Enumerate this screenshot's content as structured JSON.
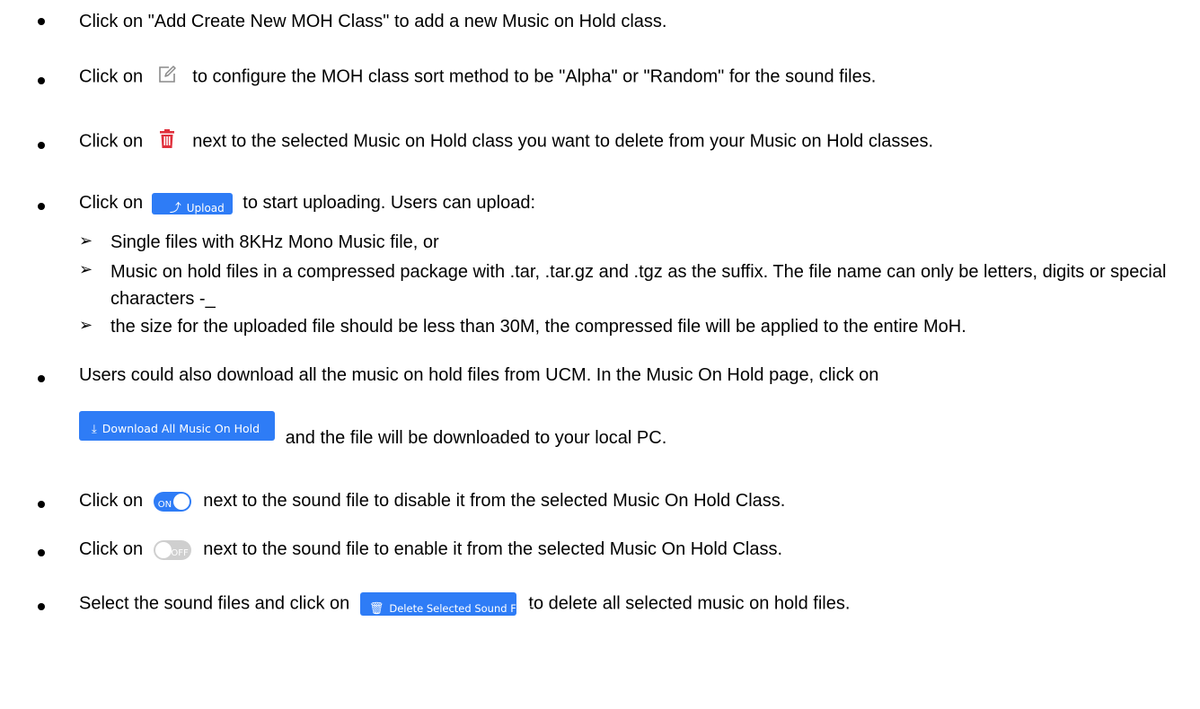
{
  "bullets": {
    "add": "Click on \"Add Create New MOH Class\" to add a new Music on Hold class.",
    "edit_pre": "Click on",
    "edit_post": "to configure the MOH class sort method to be \"Alpha\" or \"Random\" for the sound files.",
    "delete_pre": "Click on",
    "delete_post": "next to the selected Music on Hold class you want to delete from your Music on Hold classes.",
    "upload_pre": "Click on",
    "upload_post": "to start uploading. Users can upload:",
    "sub1": "Single files with 8KHz Mono Music file, or",
    "sub2": "Music on hold files in a compressed package with .tar, .tar.gz and .tgz as the suffix. The file name can only be letters, digits or special characters -_",
    "sub3": "the size for the uploaded file should be less than 30M, the compressed file will be applied to the entire MoH.",
    "download_text": "Users could also download all the music on hold files from UCM. In the Music On Hold page, click on",
    "download_post": "and the file will be downloaded to your local PC.",
    "toggle_on_pre": "Click on",
    "toggle_on_post": "next to the sound file to disable it from the selected Music On Hold Class.",
    "toggle_off_pre": "Click on",
    "toggle_off_post": "next to the sound file to enable it from the selected Music On Hold Class.",
    "deleteall_pre": "Select the sound files and click on",
    "deleteall_post": "to delete all selected music on hold files."
  },
  "buttons": {
    "upload": "Upload",
    "download_all": "Download All Music On Hold",
    "delete_selected": "Delete Selected Sound Files"
  },
  "toggles": {
    "on": "ON",
    "off": "OFF"
  },
  "icons": {
    "edit": "edit-icon",
    "trash": "trash-icon",
    "upload": "upload-icon",
    "download": "download-icon"
  },
  "colors": {
    "accent": "#2e7cf6",
    "trash": "#e0303c",
    "toggle_off": "#cfcfcf"
  }
}
